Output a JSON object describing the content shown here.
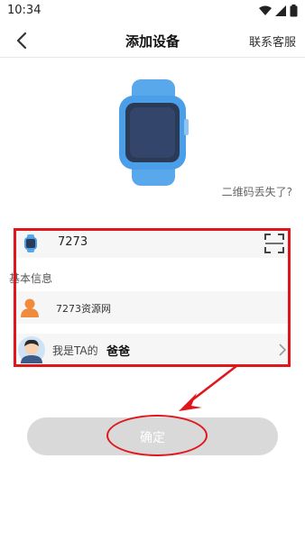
{
  "status_bar": {
    "time": "10:34",
    "icons": [
      "wifi-icon",
      "signal-icon",
      "battery-icon"
    ]
  },
  "nav": {
    "title": "添加设备",
    "right_action": "联系客服",
    "back_icon": "chevron-left-icon"
  },
  "hero": {
    "image": "smartwatch-illustration",
    "watch_band_color": "#4a9fe8",
    "watch_face_color": "#2b3a55"
  },
  "qr_lost_link": "二维码丢失了?",
  "device_row": {
    "device_id": "7273",
    "icon": "watch-icon",
    "scan_icon": "scan-icon"
  },
  "basic_info": {
    "section_label": "基本信息",
    "name_row": {
      "icon": "person-icon",
      "icon_color": "#f08a3c",
      "name": "7273资源网"
    },
    "relation_row": {
      "avatar": "dad-avatar-icon",
      "prefix": "我是TA的",
      "relation": "爸爸",
      "chevron": "chevron-right-icon"
    }
  },
  "confirm_button": {
    "label": "确定",
    "bg_color": "#d9d9d9"
  },
  "annotations": {
    "color": "#e1161b"
  }
}
